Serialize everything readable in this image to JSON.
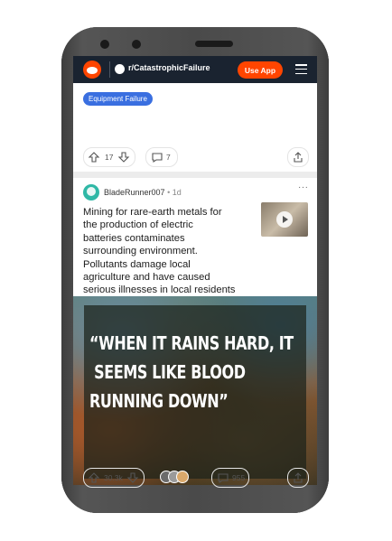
{
  "header": {
    "subreddit": "r/CatastrophicFailure",
    "use_app_label": "Use App",
    "colors": {
      "bar": "#1a2330",
      "accent": "#ff4500"
    }
  },
  "previous_post": {
    "flair": "Equipment Failure",
    "votes": "17",
    "comments": "7"
  },
  "post": {
    "author": "BladeRunner007",
    "separator": "•",
    "age": "1d",
    "more_label": "···",
    "title_lines": [
      "Mining for rare-earth metals for",
      "the production of electric",
      "batteries contaminates",
      "surrounding environment.",
      "Pollutants damage local",
      "agriculture and have caused",
      "serious illnesses in local residents"
    ],
    "quote_lines": [
      "“When it rains hard, it",
      " seems like blood",
      "running down”"
    ],
    "votes": "30.3k",
    "comments": "955"
  },
  "icons": [
    "reddit-logo-icon",
    "menu-icon",
    "upvote-icon",
    "downvote-icon",
    "comment-icon",
    "share-icon",
    "play-icon",
    "award-icon"
  ]
}
